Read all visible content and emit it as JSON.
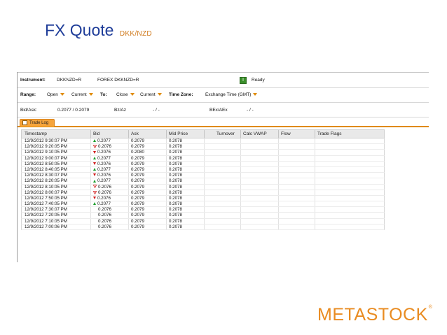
{
  "slide": {
    "title": "FX Quote",
    "subtitle": "DKK/NZD",
    "logo": "METASTOCK",
    "logo_mark": "®"
  },
  "toolbar": {
    "instrument_label": "Instrument:",
    "instrument_symbol": "DKKNZD=R",
    "instrument_name": "FOREX DKKNZD=R",
    "status": "Ready",
    "range_label": "Range:",
    "range_from_type": "Open",
    "range_from_value": "Current",
    "to_label": "To:",
    "range_to_type": "Close",
    "range_to_value": "Current",
    "timezone_label": "Time Zone:",
    "timezone_value": "Exchange Time (GMT)",
    "bidask_label": "Bid/Ask:",
    "bidask_value": "0.2077 / 0.2079",
    "bzaz_label": "Bz/Az",
    "bzaz_value": "- / -",
    "bexaex_label": "BEx/AEx",
    "bexaex_value": "- / -"
  },
  "tabs": [
    {
      "label": "Trade Log",
      "active": true
    }
  ],
  "table": {
    "columns": [
      "Timestamp",
      "Bid",
      "Ask",
      "Mid Price",
      "Turnover",
      "Calc VWAP",
      "Flow",
      "Trade Flags"
    ],
    "rows": [
      {
        "time": "12/9/2012 9:30:07 PM",
        "dir": "up",
        "bid": "0.2077",
        "ask": "0.2079",
        "mid": "0.2078"
      },
      {
        "time": "12/9/2012 9:20:05 PM",
        "dir": "down-open",
        "bid": "0.2076",
        "ask": "0.2079",
        "mid": "0.2078"
      },
      {
        "time": "12/9/2012 9:10:05 PM",
        "dir": "down",
        "bid": "0.2076",
        "ask": "0.2080",
        "mid": "0.2078"
      },
      {
        "time": "12/9/2012 9:00:07 PM",
        "dir": "up",
        "bid": "0.2077",
        "ask": "0.2079",
        "mid": "0.2078"
      },
      {
        "time": "12/9/2012 8:50:05 PM",
        "dir": "down",
        "bid": "0.2076",
        "ask": "0.2079",
        "mid": "0.2078"
      },
      {
        "time": "12/9/2012 8:40:05 PM",
        "dir": "up",
        "bid": "0.2077",
        "ask": "0.2079",
        "mid": "0.2078"
      },
      {
        "time": "12/9/2012 8:30:07 PM",
        "dir": "down",
        "bid": "0.2076",
        "ask": "0.2079",
        "mid": "0.2078"
      },
      {
        "time": "12/9/2012 8:20:05 PM",
        "dir": "up",
        "bid": "0.2077",
        "ask": "0.2079",
        "mid": "0.2078"
      },
      {
        "time": "12/9/2012 8:10:05 PM",
        "dir": "down-open",
        "bid": "0.2076",
        "ask": "0.2079",
        "mid": "0.2078"
      },
      {
        "time": "12/9/2012 8:00:07 PM",
        "dir": "down-open",
        "bid": "0.2076",
        "ask": "0.2079",
        "mid": "0.2078"
      },
      {
        "time": "12/9/2012 7:50:05 PM",
        "dir": "down",
        "bid": "0.2076",
        "ask": "0.2079",
        "mid": "0.2078"
      },
      {
        "time": "12/9/2012 7:40:05 PM",
        "dir": "up",
        "bid": "0.2077",
        "ask": "0.2079",
        "mid": "0.2078"
      },
      {
        "time": "12/9/2012 7:30:07 PM",
        "dir": "none",
        "bid": "0.2076",
        "ask": "0.2079",
        "mid": "0.2078"
      },
      {
        "time": "12/9/2012 7:20:05 PM",
        "dir": "none",
        "bid": "0.2076",
        "ask": "0.2079",
        "mid": "0.2078"
      },
      {
        "time": "12/9/2012 7:10:05 PM",
        "dir": "none",
        "bid": "0.2076",
        "ask": "0.2079",
        "mid": "0.2078"
      },
      {
        "time": "12/9/2012 7:00:06 PM",
        "dir": "none",
        "bid": "0.2076",
        "ask": "0.2079",
        "mid": "0.2078"
      }
    ]
  },
  "colors": {
    "title": "#1f3d99",
    "accent": "#e98c22",
    "up": "#1f9e2e",
    "down": "#d11a1a"
  }
}
